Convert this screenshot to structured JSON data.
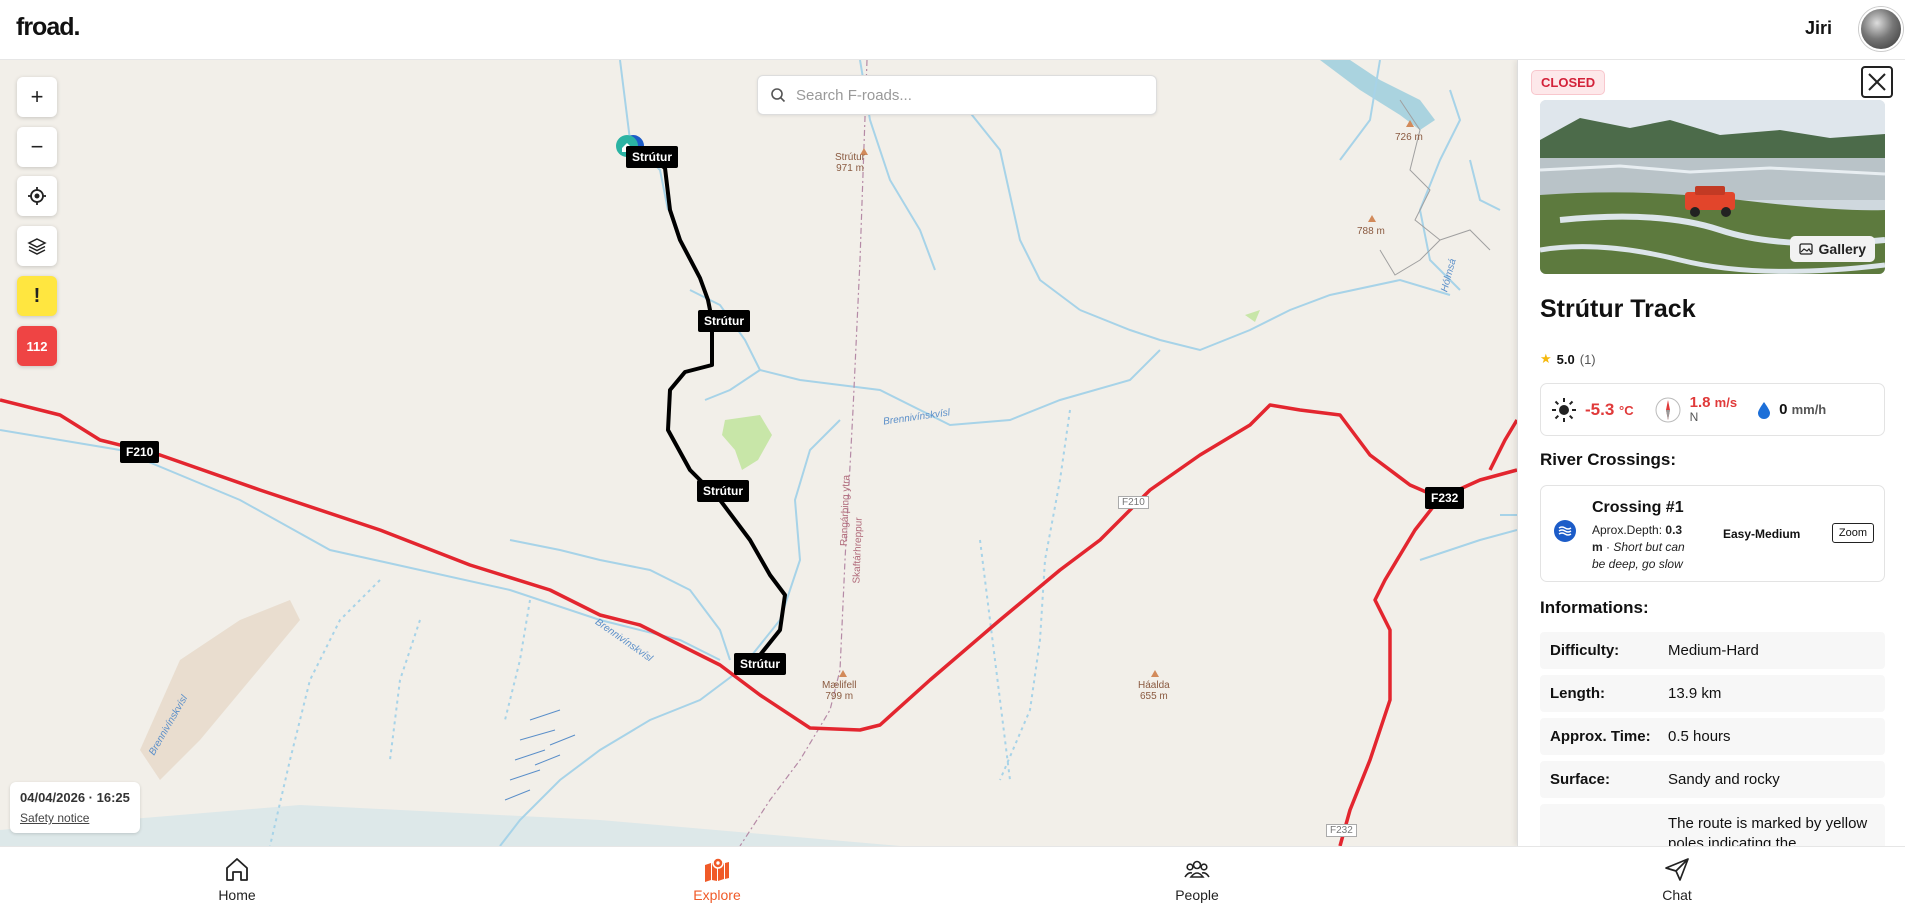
{
  "header": {
    "logo": "froad.",
    "user_name": "Jiri"
  },
  "search": {
    "placeholder": "Search F-roads..."
  },
  "map_controls": {
    "zoom_in": "+",
    "zoom_out": "−",
    "warning": "!",
    "emergency": "112"
  },
  "map": {
    "road_labels": [
      "Strútur",
      "Strútur",
      "Strútur",
      "Strútur",
      "F210",
      "F232"
    ],
    "place_labels": {
      "strutur_peak": [
        "Strútur",
        "971 m"
      ],
      "maelifell": [
        "Mælifell",
        "799 m"
      ],
      "haalda": [
        "Háalda",
        "655 m"
      ],
      "peak_726": "726 m",
      "peak_788": "788 m",
      "river_1": "Brennivínskvísl",
      "river_2": "Brennivínskvísl",
      "river_3": "Brennivínskvísl",
      "hólmsá": "Hólmsá",
      "rangarthing": "Rangárþing ytra",
      "skaftar": "Skaftárhreppur",
      "f210_small": "F210",
      "f232_small": "F232"
    }
  },
  "date_box": {
    "datetime": "04/04/2026 · 16:25",
    "safety_link": "Safety notice"
  },
  "panel": {
    "status": "CLOSED",
    "gallery_label": "Gallery",
    "title": "Strútur Track",
    "rating": {
      "value": "5.0",
      "count": "(1)"
    },
    "weather": {
      "temperature": "-5.3",
      "temperature_unit": "°C",
      "wind_speed": "1.8",
      "wind_unit": "m/s",
      "wind_direction": "N",
      "rain": "0",
      "rain_unit": "mm/h"
    },
    "river_heading": "River Crossings:",
    "crossing": {
      "title": "Crossing #1",
      "depth_label": "Aprox.Depth:",
      "depth_value": "0.3 m",
      "note": "Short but can be deep, go slow",
      "difficulty": "Easy-Medium",
      "zoom_label": "Zoom"
    },
    "info_heading": "Informations:",
    "info": [
      {
        "key": "Difficulty:",
        "value": "Medium-Hard"
      },
      {
        "key": "Length:",
        "value": "13.9  km"
      },
      {
        "key": "Approx. Time:",
        "value": "0.5 hours"
      },
      {
        "key": "Surface:",
        "value": "Sandy and rocky"
      },
      {
        "key": "",
        "value": "The route is marked by yellow poles indicating the"
      }
    ]
  },
  "bottom_nav": [
    {
      "label": "Home",
      "icon": "home-icon"
    },
    {
      "label": "Explore",
      "icon": "map-pin-icon"
    },
    {
      "label": "People",
      "icon": "people-icon"
    },
    {
      "label": "Chat",
      "icon": "send-icon"
    }
  ],
  "colors": {
    "accent": "#f05a28",
    "road_red": "#e3262f",
    "track": "#000000",
    "water": "#a7d3e8",
    "closed_red": "#d3223a"
  }
}
